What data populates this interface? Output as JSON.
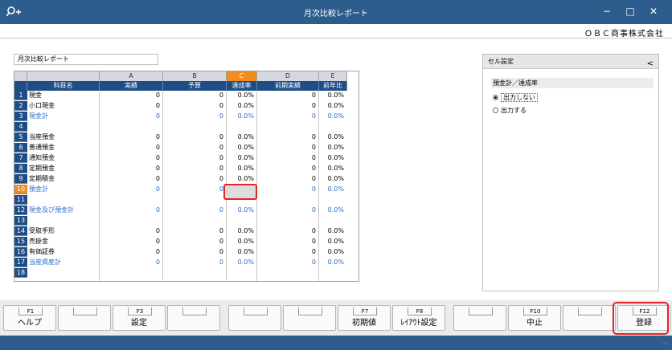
{
  "window": {
    "title": "月次比較レポート",
    "app_icon": "key-plus-icon",
    "controls": [
      "minimize-icon",
      "maximize-icon",
      "close-icon"
    ]
  },
  "company": "ＯＢＣ商事株式会社",
  "report_name": "月次比較レポート",
  "grid": {
    "col_letters": [
      "A",
      "B",
      "C",
      "D",
      "E"
    ],
    "selected_col": "C",
    "col_names": [
      "科目名",
      "実績",
      "予算",
      "達成率",
      "前期実績",
      "前年比"
    ],
    "selected_row": 10,
    "rows": [
      {
        "n": "1",
        "name": "現金",
        "v": [
          "0",
          "0",
          "0.0%",
          "0",
          "0.0%"
        ],
        "blue": false
      },
      {
        "n": "2",
        "name": "小口現金",
        "v": [
          "0",
          "0",
          "0.0%",
          "0",
          "0.0%"
        ],
        "blue": false
      },
      {
        "n": "3",
        "name": "現金計",
        "v": [
          "0",
          "0",
          "0.0%",
          "0",
          "0.0%"
        ],
        "blue": true
      },
      {
        "n": "4",
        "name": "",
        "v": [
          "",
          "",
          "",
          "",
          ""
        ],
        "blue": false
      },
      {
        "n": "5",
        "name": "当座預金",
        "v": [
          "0",
          "0",
          "0.0%",
          "0",
          "0.0%"
        ],
        "blue": false
      },
      {
        "n": "6",
        "name": "普通預金",
        "v": [
          "0",
          "0",
          "0.0%",
          "0",
          "0.0%"
        ],
        "blue": false
      },
      {
        "n": "7",
        "name": "通知預金",
        "v": [
          "0",
          "0",
          "0.0%",
          "0",
          "0.0%"
        ],
        "blue": false
      },
      {
        "n": "8",
        "name": "定期預金",
        "v": [
          "0",
          "0",
          "0.0%",
          "0",
          "0.0%"
        ],
        "blue": false
      },
      {
        "n": "9",
        "name": "定期積金",
        "v": [
          "0",
          "0",
          "0.0%",
          "0",
          "0.0%"
        ],
        "blue": false
      },
      {
        "n": "10",
        "name": "預金計",
        "v": [
          "0",
          "0",
          "",
          "0",
          "0.0%"
        ],
        "blue": true
      },
      {
        "n": "11",
        "name": "",
        "v": [
          "",
          "",
          "",
          "",
          ""
        ],
        "blue": false
      },
      {
        "n": "12",
        "name": "現金及び預金計",
        "v": [
          "0",
          "0",
          "0.0%",
          "0",
          "0.0%"
        ],
        "blue": true
      },
      {
        "n": "13",
        "name": "",
        "v": [
          "",
          "",
          "",
          "",
          ""
        ],
        "blue": false
      },
      {
        "n": "14",
        "name": "受取手形",
        "v": [
          "0",
          "0",
          "0.0%",
          "0",
          "0.0%"
        ],
        "blue": false
      },
      {
        "n": "15",
        "name": "売掛金",
        "v": [
          "0",
          "0",
          "0.0%",
          "0",
          "0.0%"
        ],
        "blue": false
      },
      {
        "n": "16",
        "name": "有価証券",
        "v": [
          "0",
          "0",
          "0.0%",
          "0",
          "0.0%"
        ],
        "blue": false
      },
      {
        "n": "17",
        "name": "当座資産計",
        "v": [
          "0",
          "0",
          "0.0%",
          "0",
          "0.0%"
        ],
        "blue": true
      },
      {
        "n": "18",
        "name": "",
        "v": [
          "",
          "",
          "",
          "",
          ""
        ],
        "blue": false
      }
    ]
  },
  "panel": {
    "title": "セル設定",
    "collapse": "<",
    "section": "預金計／達成率",
    "options": [
      {
        "label": "出力しない",
        "checked": true
      },
      {
        "label": "出力する",
        "checked": false
      }
    ]
  },
  "fkeys": [
    {
      "num": "F1",
      "label": "ヘルプ"
    },
    {
      "num": "",
      "label": ""
    },
    {
      "num": "F3",
      "label": "設定"
    },
    {
      "num": "",
      "label": ""
    },
    {
      "num": "",
      "label": ""
    },
    {
      "num": "",
      "label": ""
    },
    {
      "num": "F7",
      "label": "初期値"
    },
    {
      "num": "F8",
      "label": "ﾚｲｱｳﾄ設定"
    },
    {
      "num": "",
      "label": ""
    },
    {
      "num": "F10",
      "label": "中止"
    },
    {
      "num": "",
      "label": ""
    },
    {
      "num": "F12",
      "label": "登録"
    }
  ],
  "colors": {
    "titlebar": "#2c5d8c",
    "header": "#1f4e86",
    "selected": "#f28c1e",
    "total_text": "#2a6cc6",
    "highlight": "#e2232a"
  }
}
